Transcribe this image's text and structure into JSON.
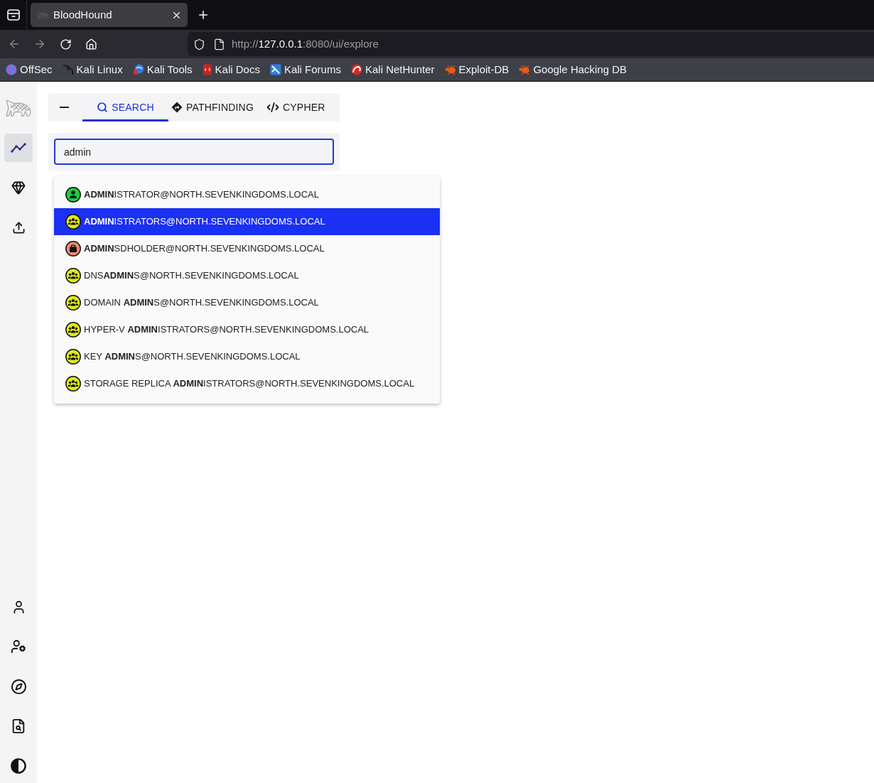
{
  "browser": {
    "tabs": [
      {
        "title": "BloodHound",
        "selected": true
      }
    ],
    "nav_buttons": [
      {
        "disabled": true
      },
      {
        "disabled": true
      },
      {
        "disabled": false
      },
      {
        "disabled": false
      }
    ],
    "address_bar": {
      "scheme": "http://",
      "host": "127.0.0.1",
      "path": ":8080/ui/explore"
    },
    "bookmarks": [
      "OffSec",
      "Kali Linux",
      "Kali Tools",
      "Kali Docs",
      "Kali Forums",
      "Kali NetHunter",
      "Exploit-DB",
      "Google Hacking DB"
    ]
  },
  "sidebar": {
    "top_items": [
      {
        "selected": true
      },
      {
        "selected": false
      },
      {
        "selected": false
      }
    ],
    "bottom_items": [
      {
        "selected": false
      },
      {
        "selected": false
      },
      {
        "selected": false
      },
      {
        "selected": false
      },
      {
        "selected": false
      }
    ]
  },
  "explore": {
    "tabs": [
      {
        "label": "SEARCH",
        "selected": true
      },
      {
        "label": "PATHFINDING",
        "selected": false
      },
      {
        "label": "CYPHER",
        "selected": false
      }
    ],
    "search": {
      "value": "admin"
    },
    "results": [
      {
        "kind": "user",
        "label": "**ADMIN**ISTRATOR@NORTH.SEVENKINGDOMS.LOCAL",
        "selected": false
      },
      {
        "kind": "group",
        "label": "**ADMIN**ISTRATORS@NORTH.SEVENKINGDOMS.LOCAL",
        "selected": true
      },
      {
        "kind": "container",
        "label": "**ADMIN**SDHOLDER@NORTH.SEVENKINGDOMS.LOCAL",
        "selected": false
      },
      {
        "kind": "group",
        "label": "DNS**ADMIN**S@NORTH.SEVENKINGDOMS.LOCAL",
        "selected": false
      },
      {
        "kind": "group",
        "label": "DOMAIN **ADMIN**S@NORTH.SEVENKINGDOMS.LOCAL",
        "selected": false
      },
      {
        "kind": "group",
        "label": "HYPER-V **ADMIN**ISTRATORS@NORTH.SEVENKINGDOMS.LOCAL",
        "selected": false
      },
      {
        "kind": "group",
        "label": "KEY **ADMIN**S@NORTH.SEVENKINGDOMS.LOCAL",
        "selected": false
      },
      {
        "kind": "group",
        "label": "STORAGE REPLICA **ADMIN**ISTRATORS@NORTH.SEVENKINGDOMS.LOCAL",
        "selected": false
      }
    ]
  }
}
